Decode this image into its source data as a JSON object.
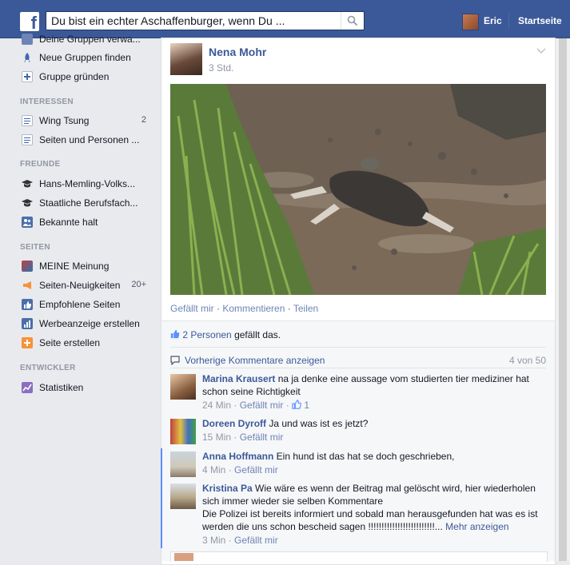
{
  "topbar": {
    "logo": "f",
    "search_value": "Du bist ein echter Aschaffenburger, wenn Du ...",
    "search_icon": "search-icon",
    "user_name": "Eric",
    "home_label": "Startseite"
  },
  "sidebar": {
    "items_top": [
      {
        "label": "Deine Gruppen verwa...",
        "icon": "groups-icon"
      },
      {
        "label": "Neue Gruppen finden",
        "icon": "rocket-icon"
      },
      {
        "label": "Gruppe gründen",
        "icon": "plus-icon"
      }
    ],
    "interests_header": "INTERESSEN",
    "interests": [
      {
        "label": "Wing Tsung",
        "count": "2",
        "icon": "list-icon"
      },
      {
        "label": "Seiten und Personen ...",
        "count": "",
        "icon": "list-icon"
      }
    ],
    "friends_header": "FREUNDE",
    "friends": [
      {
        "label": "Hans-Memling-Volks...",
        "icon": "graduation-icon"
      },
      {
        "label": "Staatliche Berufsfach...",
        "icon": "graduation-icon"
      },
      {
        "label": "Bekannte halt",
        "icon": "people-icon"
      }
    ],
    "pages_header": "SEITEN",
    "pages": [
      {
        "label": "MEINE Meinung",
        "count": "",
        "icon": "page-icon"
      },
      {
        "label": "Seiten-Neuigkeiten",
        "count": "20+",
        "icon": "megaphone-icon"
      },
      {
        "label": "Empfohlene Seiten",
        "count": "",
        "icon": "thumbs-up-icon"
      },
      {
        "label": "Werbeanzeige erstellen",
        "count": "",
        "icon": "chart-icon"
      },
      {
        "label": "Seite erstellen",
        "count": "",
        "icon": "plus-icon"
      }
    ],
    "dev_header": "ENTWICKLER",
    "dev": [
      {
        "label": "Statistiken",
        "icon": "stats-icon"
      }
    ]
  },
  "post": {
    "author": "Nena Mohr",
    "time": "3 Std.",
    "actions": {
      "like": "Gefällt mir",
      "comment": "Kommentieren",
      "share": "Teilen",
      "sep": " · "
    },
    "likes_count": "2 Personen",
    "likes_suffix": " gefällt das.",
    "prev_comments": "Vorherige Kommentare anzeigen",
    "comment_count": "4 von 50"
  },
  "comments": [
    {
      "name": "Marina Krausert",
      "text": " na ja denke eine aussage vom studierten tier mediziner hat schon seine Richtigkeit",
      "time": "24 Min",
      "like": "Gefällt mir",
      "likes": "1"
    },
    {
      "name": "Doreen Dyroff",
      "text": " Ja und was ist es jetzt?",
      "time": "15 Min",
      "like": "Gefällt mir",
      "likes": ""
    },
    {
      "name": "Anna Hoffmann",
      "text": " Ein hund ist das hat se doch geschrieben,",
      "time": "4 Min",
      "like": "Gefällt mir",
      "likes": ""
    },
    {
      "name": "Kristina Pa",
      "text": " Wie wäre es wenn der Beitrag mal gelöscht wird, hier wiederholen sich immer wieder sie selben Kommentare",
      "text2": "Die Polizei ist bereits informiert und sobald man herausgefunden hat was es ist werden die uns schon bescheid sagen !!!!!!!!!!!!!!!!!!!!!!!!!...",
      "more": " Mehr anzeigen",
      "time": "3 Min",
      "like": "Gefällt mir",
      "likes": ""
    }
  ]
}
